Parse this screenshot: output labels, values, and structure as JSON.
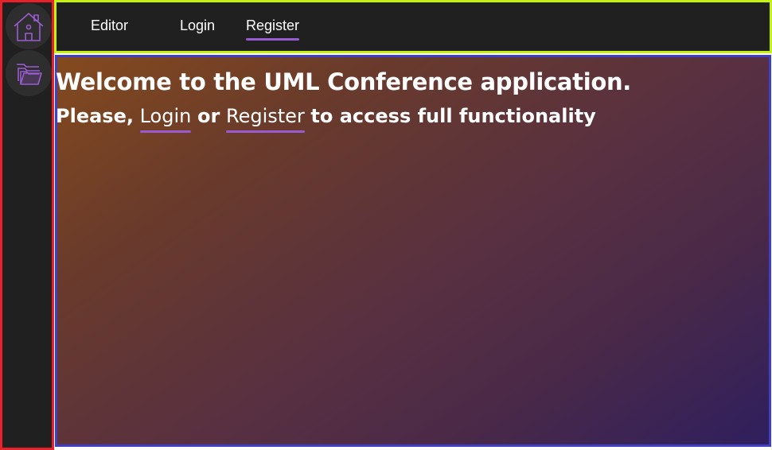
{
  "nav": {
    "tabs": [
      {
        "label": "Editor"
      },
      {
        "label": "Login"
      },
      {
        "label": "Register",
        "active": true
      }
    ]
  },
  "sidebar": {
    "items": [
      {
        "icon": "home-icon"
      },
      {
        "icon": "folder-icon"
      }
    ]
  },
  "main": {
    "title": "Welcome to the UML Conference application.",
    "subtitle": {
      "prefix": "Please,",
      "login_link": "Login",
      "middle": "or",
      "register_link": "Register",
      "suffix": "to access full functionality"
    }
  },
  "colors": {
    "accent": "#9a5bd0",
    "bar_bg": "#202020",
    "gradient_start": "#844a1e",
    "gradient_end": "#2f1f5e"
  }
}
